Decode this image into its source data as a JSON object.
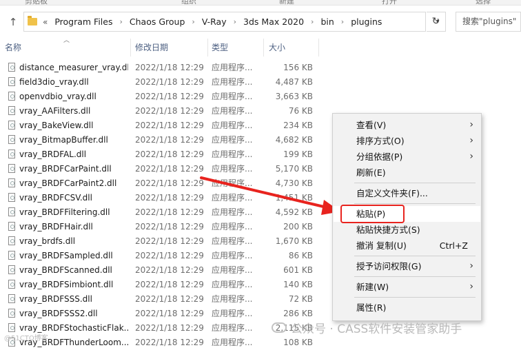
{
  "ribbon": {
    "labels": [
      "剪贴板",
      "组织",
      "新建",
      "打开",
      "选择"
    ]
  },
  "address": {
    "overflow": "«",
    "crumbs": [
      "Program Files",
      "Chaos Group",
      "V-Ray",
      "3ds Max 2020",
      "bin",
      "plugins"
    ],
    "dropdown_icon": "chevron-down-icon",
    "refresh_icon": "refresh-icon"
  },
  "search": {
    "placeholder": "搜索\"plugins\""
  },
  "columns": {
    "name": "名称",
    "date": "修改日期",
    "type": "类型",
    "size": "大小"
  },
  "files": [
    {
      "name": "distance_measurer_vray.dll",
      "date": "2022/1/18 12:29",
      "type": "应用程序...",
      "size": "156 KB"
    },
    {
      "name": "field3dio_vray.dll",
      "date": "2022/1/18 12:29",
      "type": "应用程序...",
      "size": "4,487 KB"
    },
    {
      "name": "openvdbio_vray.dll",
      "date": "2022/1/18 12:29",
      "type": "应用程序...",
      "size": "3,663 KB"
    },
    {
      "name": "vray_AAFilters.dll",
      "date": "2022/1/18 12:29",
      "type": "应用程序...",
      "size": "76 KB"
    },
    {
      "name": "vray_BakeView.dll",
      "date": "2022/1/18 12:29",
      "type": "应用程序...",
      "size": "234 KB"
    },
    {
      "name": "vray_BitmapBuffer.dll",
      "date": "2022/1/18 12:29",
      "type": "应用程序...",
      "size": "4,682 KB"
    },
    {
      "name": "vray_BRDFAL.dll",
      "date": "2022/1/18 12:29",
      "type": "应用程序...",
      "size": "199 KB"
    },
    {
      "name": "vray_BRDFCarPaint.dll",
      "date": "2022/1/18 12:29",
      "type": "应用程序...",
      "size": "5,170 KB"
    },
    {
      "name": "vray_BRDFCarPaint2.dll",
      "date": "2022/1/18 12:29",
      "type": "应用程序...",
      "size": "4,730 KB"
    },
    {
      "name": "vray_BRDFCSV.dll",
      "date": "2022/1/18 12:29",
      "type": "应用程序...",
      "size": "1,451 KB"
    },
    {
      "name": "vray_BRDFFiltering.dll",
      "date": "2022/1/18 12:29",
      "type": "应用程序...",
      "size": "4,592 KB"
    },
    {
      "name": "vray_BRDFHair.dll",
      "date": "2022/1/18 12:29",
      "type": "应用程序...",
      "size": "200 KB"
    },
    {
      "name": "vray_brdfs.dll",
      "date": "2022/1/18 12:29",
      "type": "应用程序...",
      "size": "1,670 KB"
    },
    {
      "name": "vray_BRDFSampled.dll",
      "date": "2022/1/18 12:29",
      "type": "应用程序...",
      "size": "86 KB"
    },
    {
      "name": "vray_BRDFScanned.dll",
      "date": "2022/1/18 12:29",
      "type": "应用程序...",
      "size": "601 KB"
    },
    {
      "name": "vray_BRDFSimbiont.dll",
      "date": "2022/1/18 12:29",
      "type": "应用程序...",
      "size": "140 KB"
    },
    {
      "name": "vray_BRDFSSS.dll",
      "date": "2022/1/18 12:29",
      "type": "应用程序...",
      "size": "72 KB"
    },
    {
      "name": "vray_BRDFSSS2.dll",
      "date": "2022/1/18 12:29",
      "type": "应用程序...",
      "size": "286 KB"
    },
    {
      "name": "vray_BRDFStochasticFlak...",
      "date": "2022/1/18 12:29",
      "type": "应用程序...",
      "size": "2,115 KB"
    },
    {
      "name": "vray_BRDFThunderLoom....",
      "date": "2022/1/18 12:29",
      "type": "应用程序...",
      "size": "108 KB"
    }
  ],
  "context_menu": {
    "items": [
      {
        "label": "查看(V)",
        "submenu": true
      },
      {
        "label": "排序方式(O)",
        "submenu": true
      },
      {
        "label": "分组依据(P)",
        "submenu": true
      },
      {
        "label": "刷新(E)",
        "submenu": false
      },
      {
        "label": "自定义文件夹(F)...",
        "submenu": false
      },
      {
        "label": "粘贴(P)",
        "submenu": false,
        "highlighted": true
      },
      {
        "label": "粘贴快捷方式(S)",
        "submenu": false
      },
      {
        "label": "撤消 复制(U)",
        "shortcut": "Ctrl+Z",
        "submenu": false
      },
      {
        "label": "授予访问权限(G)",
        "submenu": true
      },
      {
        "label": "新建(W)",
        "submenu": true
      },
      {
        "label": "属性(R)",
        "submenu": false
      }
    ]
  },
  "annotation": {
    "color": "#e8231e"
  },
  "watermark": {
    "text": "公众号 · CASS软件安装管家助手",
    "icon": "wechat-icon"
  },
  "corner_logo": {
    "text": "@51CTO博客"
  }
}
